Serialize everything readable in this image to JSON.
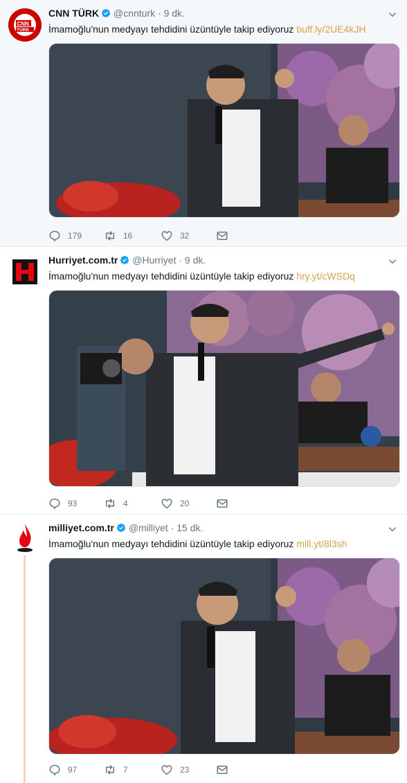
{
  "tweets": [
    {
      "name": "CNN TÜRK",
      "handle": "@cnnturk",
      "dot": "·",
      "time": "9 dk.",
      "text": "İmamoğlu'nun medyayı tehdidini üzüntüyle takip ediyoruz",
      "link": "buff.ly/2UE4kJH",
      "replies": "179",
      "retweets": "16",
      "likes": "32",
      "avatar_logo": "CNN TÜRK logo"
    },
    {
      "name": "Hurriyet.com.tr",
      "handle": "@Hurriyet",
      "dot": "·",
      "time": "9 dk.",
      "text": "İmamoğlu'nun medyayı tehdidini üzüntüyle takip ediyoruz",
      "link": "hry.yt/cWSDq",
      "replies": "93",
      "retweets": "4",
      "likes": "20",
      "avatar_logo": "H"
    },
    {
      "name": "milliyet.com.tr",
      "handle": "@milliyet",
      "dot": "·",
      "time": "15 dk.",
      "text": "İmamoğlu'nun medyayı tehdidini üzüntüyle takip ediyoruz",
      "link": "mill.yt/8l3sh",
      "replies": "97",
      "retweets": "7",
      "likes": "23",
      "avatar_logo": "milliyet flame logo"
    }
  ],
  "icons": [
    "verified-badge-icon",
    "chevron-down-icon",
    "reply-icon",
    "retweet-icon",
    "like-icon",
    "direct-message-icon"
  ],
  "colors": {
    "verified": "#1da1f2",
    "link": "#d9a14a",
    "meta": "#657786",
    "hurriyet_red": "#e30613",
    "cnn_red": "#cc0000"
  }
}
